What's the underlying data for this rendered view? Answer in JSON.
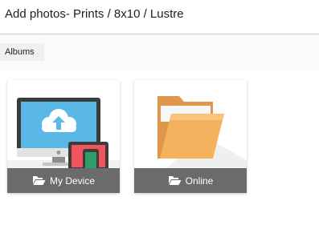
{
  "header": {
    "title": "Add photos- Prints / 8x10 / Lustre"
  },
  "tabs": {
    "albums_label": "Albums"
  },
  "sources": [
    {
      "label": "My Device",
      "icon": "folder-open-icon",
      "art": "computer-tablet-phone-illustration"
    },
    {
      "label": "Online",
      "icon": "folder-open-icon",
      "art": "folder-illustration"
    }
  ],
  "colors": {
    "footer": "#6b6b6b",
    "folder": "#f4b25e",
    "screen": "#5ab8e6",
    "tablet": "#f2545b",
    "phone": "#2f9e6a"
  }
}
